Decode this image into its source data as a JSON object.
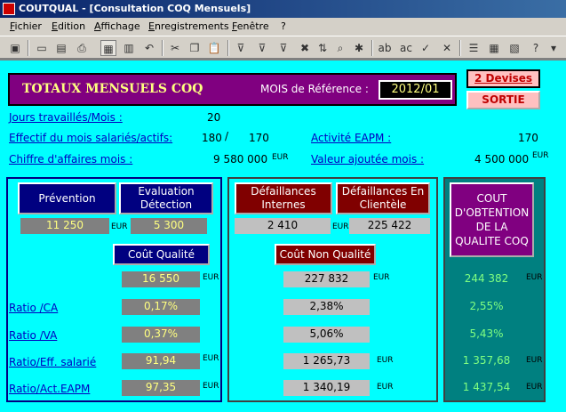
{
  "window": {
    "title": "COUTQUAL - [Consultation COQ Mensuels]"
  },
  "menu": [
    "Fichier",
    "Edition",
    "Affichage",
    "Enregistrements",
    "Fenêtre",
    "?"
  ],
  "header": {
    "title": "TOTAUX MENSUELS COQ",
    "mois_label": "MOIS de Référence :",
    "mois_value": "2012/01",
    "devises_button": "2 Devises",
    "sortie_button": "SORTIE"
  },
  "stats": {
    "jours_label": "Jours travaillés/Mois :",
    "jours_value": "20",
    "effectif_label": "Effectif du mois salariés/actifs:",
    "effectif_value1": "180",
    "effectif_sep": "/",
    "effectif_value2": "170",
    "ca_label": "Chiffre d'affaires mois :",
    "ca_value": "9 580 000",
    "ca_unit": "EUR",
    "activite_label": "Activité EAPM :",
    "activite_value": "170",
    "va_label": "Valeur ajoutée mois :",
    "va_value": "4 500 000",
    "va_unit": "EUR"
  },
  "prevention": {
    "prevention_button": "Prévention",
    "evaluation_button": "Evaluation Détection",
    "prevention_value": "11 250",
    "evaluation_value": "5 300",
    "unit": "EUR",
    "cout_qualite_button": "Coût Qualité",
    "total": "16 550",
    "total_unit": "EUR",
    "ratio_ca": "0,17%",
    "ratio_va": "0,37%",
    "ratio_eff": "91,94",
    "ratio_eff_unit": "EUR",
    "ratio_act": "97,35",
    "ratio_act_unit": "EUR"
  },
  "non_qualite": {
    "internes_button": "Défaillances Internes",
    "clientele_button": "Défaillances En Clientèle",
    "internes_value": "2 410",
    "clientele_value": "225 422",
    "unit": "EUR",
    "cout_non_qualite_button": "Coût Non Qualité",
    "total": "227 832",
    "total_unit": "EUR",
    "ratio_ca": "2,38%",
    "ratio_va": "5,06%",
    "ratio_eff": "1 265,73",
    "ratio_eff_unit": "EUR",
    "ratio_act": "1 340,19",
    "ratio_act_unit": "EUR"
  },
  "cout_obtention": {
    "button": "COUT D'OBTENTION DE LA QUALITE COQ",
    "total": "244 382",
    "total_unit": "EUR",
    "ratio_ca": "2,55%",
    "ratio_va": "5,43%",
    "ratio_eff": "1 357,68",
    "ratio_eff_unit": "EUR",
    "ratio_act": "1 437,54",
    "ratio_act_unit": "EUR"
  },
  "ratios": {
    "ca_label": "Ratio /CA",
    "va_label": "Ratio /VA",
    "eff_label": "Ratio/Eff. salarié",
    "act_label": "Ratio/Act.EAPM"
  },
  "colors": {
    "form_bg": "#00ffff",
    "header_bg": "#800080",
    "prevention_btn": "#000080",
    "nonq_btn": "#800000",
    "coq_bg": "#008080"
  }
}
